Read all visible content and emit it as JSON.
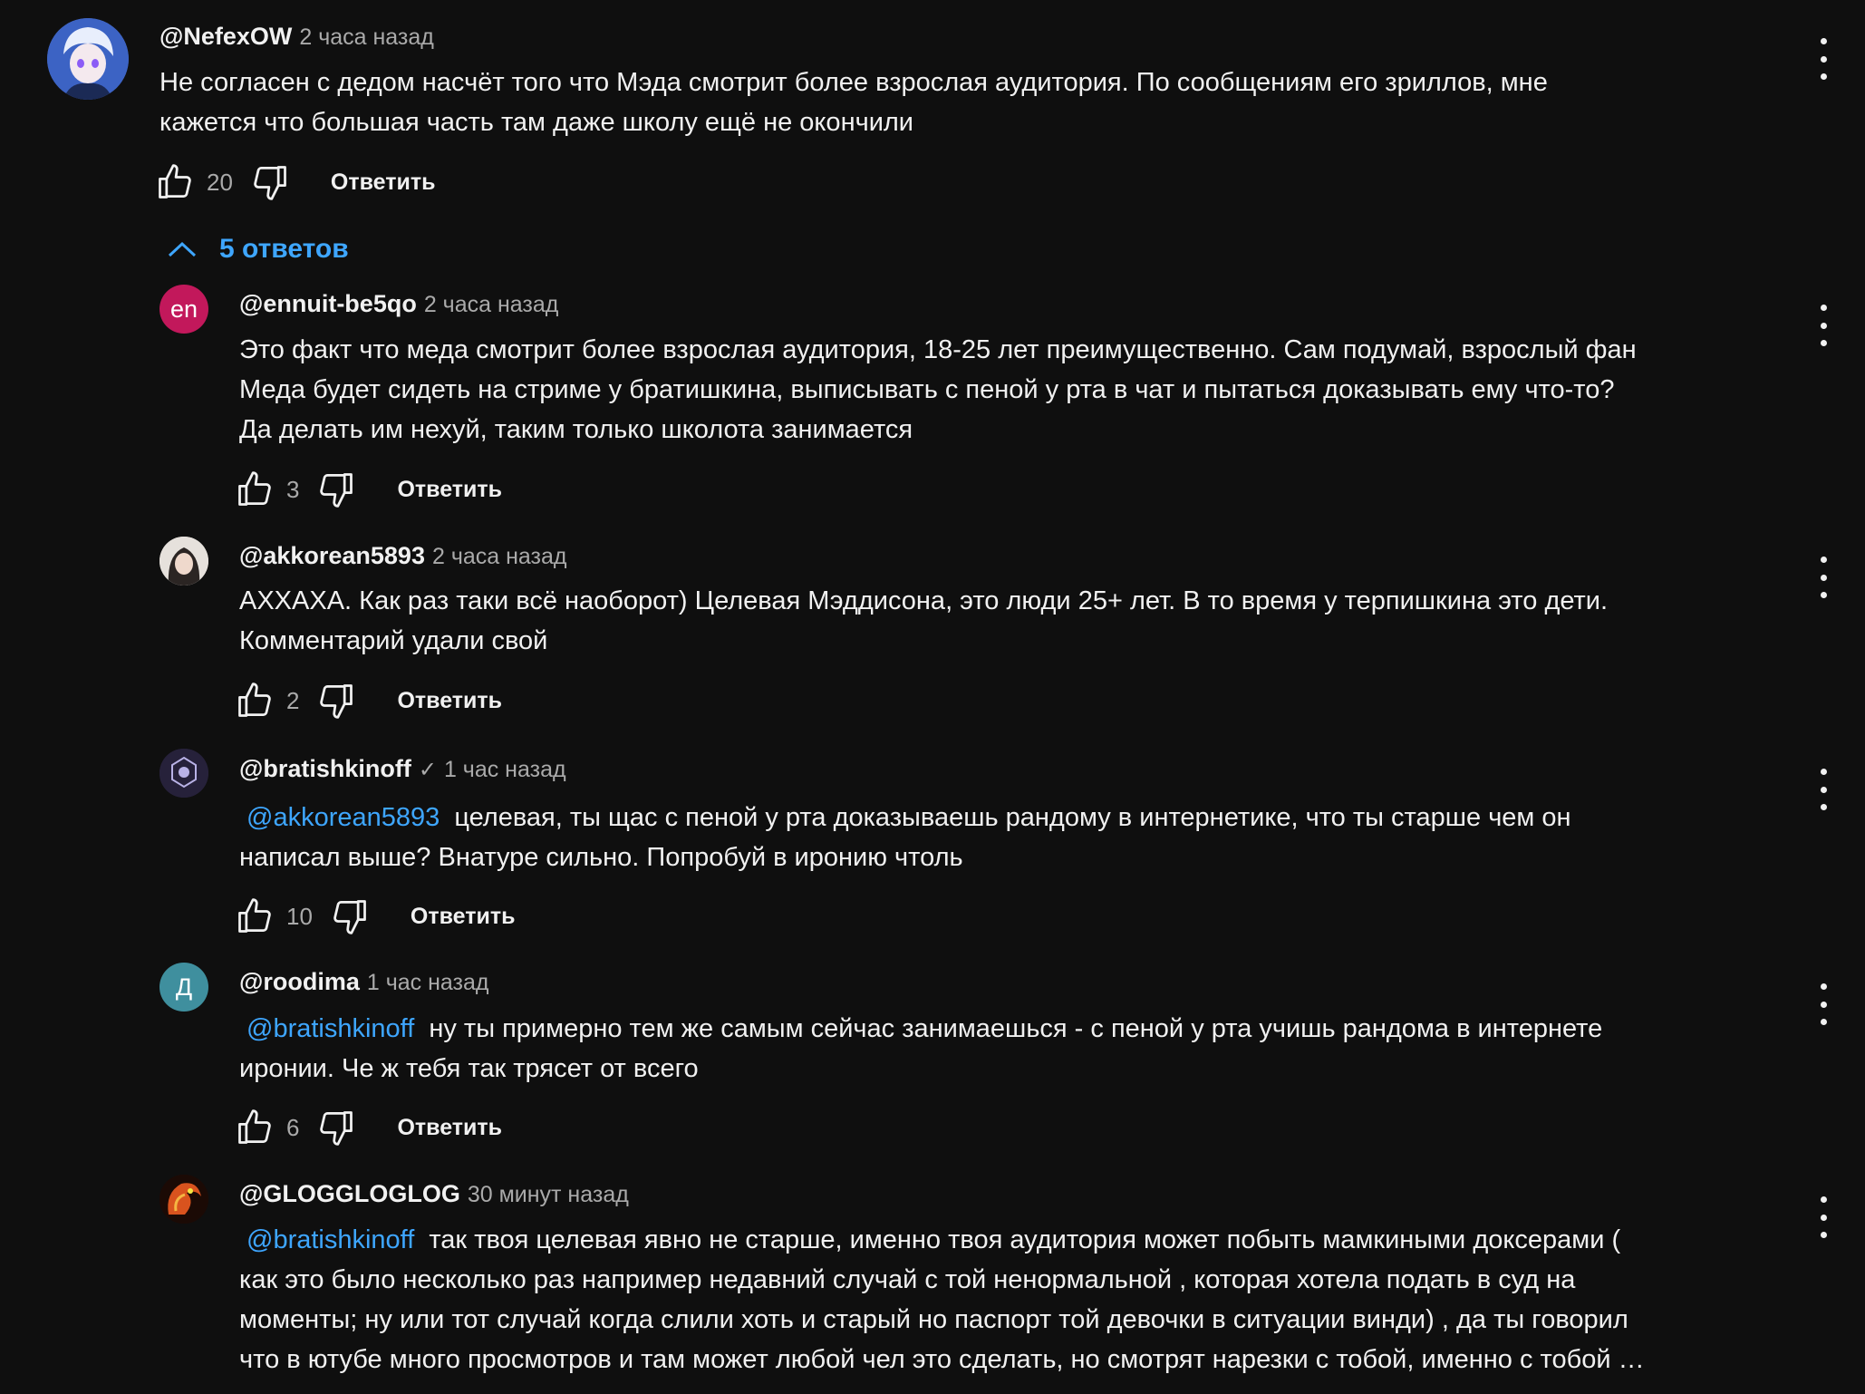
{
  "top": {
    "author": "@NefexOW",
    "time": "2 часа назад",
    "text": "Не согласен с дедом насчёт того что Мэда смотрит более взрослая аудитория. По сообщениям его зриллов, мне\nкажется что большая часть там даже школу ещё не окончили",
    "likes": "20",
    "reply": "Ответить"
  },
  "replies_toggle": "5 ответов",
  "replies": [
    {
      "avatar_text": "en",
      "author": "@ennuit-be5qo",
      "time": "2 часа назад",
      "text": "Это факт что меда смотрит более взрослая аудитория, 18-25 лет преимущественно. Сам подумай, взрослый фан\nМеда будет сидеть на стриме у братишкина, выписывать с пеной у рта в чат и пытаться доказывать ему что-то?\nДа делать им нехуй, таким только школота занимается",
      "likes": "3",
      "reply": "Ответить"
    },
    {
      "author": "@akkorean5893",
      "time": "2 часа назад",
      "text": "АХХАХА. Как раз таки всё наоборот) Целевая Мэддисона, это люди 25+ лет. В то время у терпишкина это дети.\nКомментарий удали свой",
      "likes": "2",
      "reply": "Ответить"
    },
    {
      "author": "@bratishkinoff",
      "verified": "✓",
      "time": "1 час назад",
      "mention": "@akkorean5893",
      "text": "целевая, ты щас с пеной у рта доказываешь рандому в интернетике, что ты старше чем он\nнаписал выше? Внатуре сильно. Попробуй в иронию чтоль",
      "likes": "10",
      "reply": "Ответить"
    },
    {
      "avatar_text": "Д",
      "author": "@roodima",
      "time": "1 час назад",
      "mention": "@bratishkinoff",
      "text": "ну ты примерно тем же самым сейчас занимаешься  - с пеной у рта учишь рандома в интернете\nиронии. Че ж тебя так трясет от всего",
      "likes": "6",
      "reply": "Ответить"
    },
    {
      "author": "@GLOGGLOGLOG",
      "time": "30 минут назад",
      "mention": "@bratishkinoff",
      "text": "так твоя целевая явно не старше,  именно твоя аудитория может побыть мамкиными доксерами (\nкак это было несколько раз например недавний случай с той ненормальной , которая хотела подать в суд на\nмоменты; ну или тот случай когда слили хоть и старый но паспорт той девочки в ситуации винди) , да ты говорил\nчто в ютубе много просмотров и там может любой чел это сделать, но смотрят нарезки с тобой, именно с тобой …"
    }
  ],
  "colors": {
    "background": "#0f0f0f",
    "text": "#f1f1f1",
    "muted": "#aaaaaa",
    "link": "#3ea6ff"
  }
}
